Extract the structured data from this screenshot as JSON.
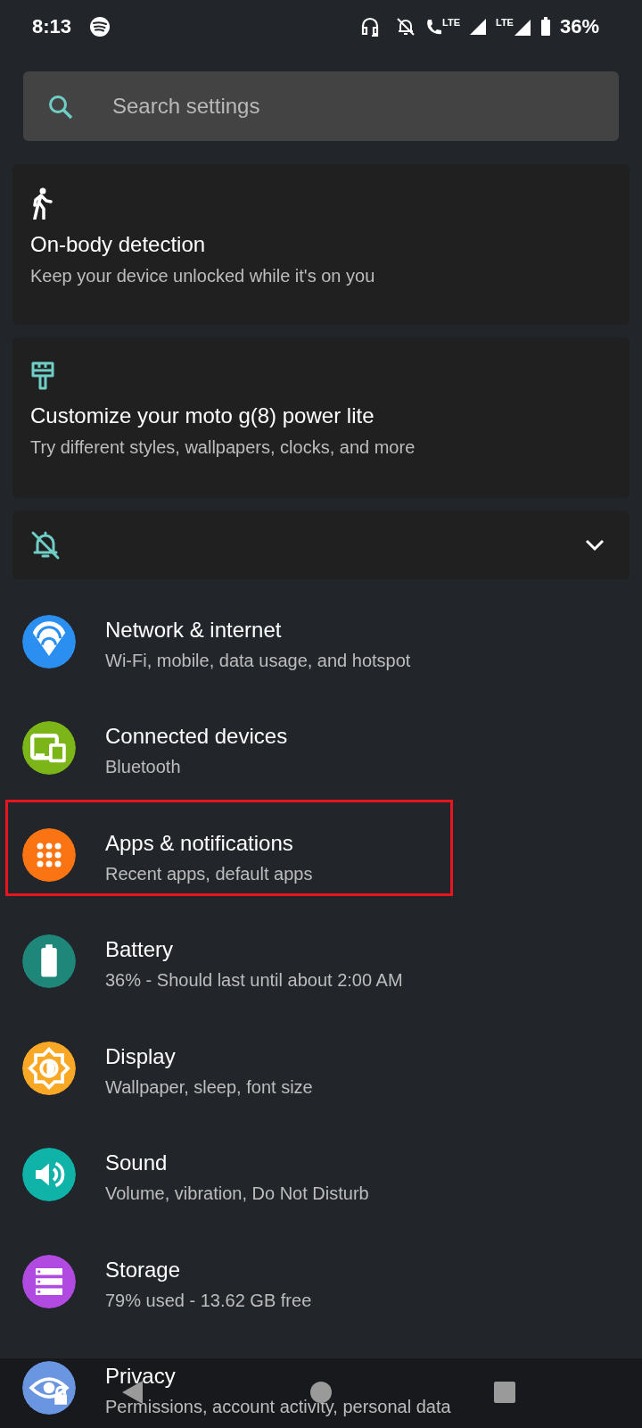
{
  "status_bar": {
    "time": "8:13",
    "call_network": "LTE",
    "data_network": "LTE",
    "battery": "36%"
  },
  "search": {
    "placeholder": "Search settings"
  },
  "cards": [
    {
      "kind": "walk",
      "title": "On-body detection",
      "subtitle": "Keep your device unlocked while it's on you"
    },
    {
      "kind": "brush",
      "title": "Customize your moto g(8) power lite",
      "subtitle": "Try different styles, wallpapers, clocks, and more"
    },
    {
      "kind": "bell-off",
      "expanded": false
    }
  ],
  "items": [
    {
      "kind": "wifi",
      "title": "Network & internet",
      "subtitle": "Wi-Fi, mobile, data usage, and hotspot",
      "color": "#2a8ff0",
      "highlighted": false
    },
    {
      "kind": "devices",
      "title": "Connected devices",
      "subtitle": "Bluetooth",
      "color": "#7cb518",
      "highlighted": false
    },
    {
      "kind": "apps",
      "title": "Apps & notifications",
      "subtitle": "Recent apps, default apps",
      "color": "#fb7414",
      "highlighted": true
    },
    {
      "kind": "battery",
      "title": "Battery",
      "subtitle": "36% - Should last until about 2:00 AM",
      "color": "#1f877a",
      "highlighted": false
    },
    {
      "kind": "display",
      "title": "Display",
      "subtitle": "Wallpaper, sleep, font size",
      "color": "#f9a825",
      "highlighted": false
    },
    {
      "kind": "sound",
      "title": "Sound",
      "subtitle": "Volume, vibration, Do Not Disturb",
      "color": "#0fb3a8",
      "highlighted": false
    },
    {
      "kind": "storage",
      "title": "Storage",
      "subtitle": "79% used - 13.62 GB free",
      "color": "#b04ae0",
      "highlighted": false
    },
    {
      "kind": "privacy",
      "title": "Privacy",
      "subtitle": "Permissions, account activity, personal data",
      "color": "#6a95e0",
      "highlighted": false
    }
  ]
}
